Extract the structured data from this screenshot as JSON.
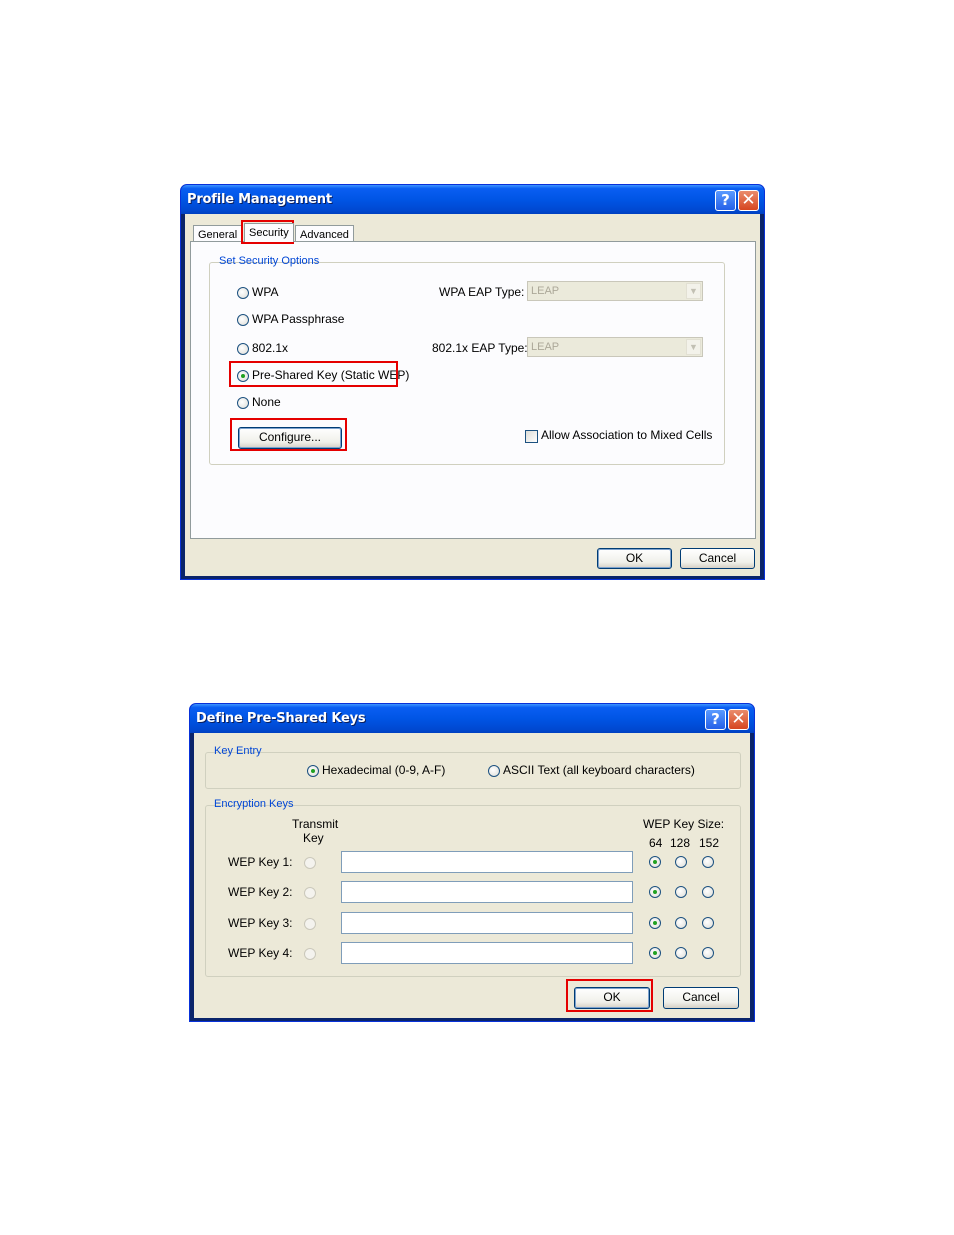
{
  "profile_dialog": {
    "title": "Profile Management",
    "help_glyph": "?",
    "close_glyph": "✕",
    "tabs": [
      "General",
      "Security",
      "Advanced"
    ],
    "active_tab": "Security",
    "group_label": "Set Security Options",
    "options": {
      "wpa": "WPA",
      "wpa_passphrase": "WPA Passphrase",
      "dot1x": "802.1x",
      "psk": "Pre-Shared Key (Static WEP)",
      "none": "None"
    },
    "selected_option": "Pre-Shared Key (Static WEP)",
    "wpa_eap_label": "WPA EAP Type:",
    "wpa_eap_value": "LEAP",
    "dot1x_eap_label": "802.1x EAP Type:",
    "dot1x_eap_value": "LEAP",
    "configure_label": "Configure...",
    "mixed_cells_label": "Allow Association to Mixed Cells",
    "mixed_cells_checked": false,
    "ok_label": "OK",
    "cancel_label": "Cancel"
  },
  "psk_dialog": {
    "title": "Define Pre-Shared Keys",
    "help_glyph": "?",
    "close_glyph": "✕",
    "key_entry_label": "Key Entry",
    "hex_label": "Hexadecimal (0-9, A-F)",
    "ascii_label": "ASCII Text (all keyboard characters)",
    "selected_entry": "Hexadecimal (0-9, A-F)",
    "enc_keys_label": "Encryption Keys",
    "transmit_label_1": "Transmit",
    "transmit_label_2": "Key",
    "size_label": "WEP Key Size:",
    "sizes": [
      "64",
      "128",
      "152"
    ],
    "keys": [
      {
        "label": "WEP Key 1:",
        "value": "",
        "size": "64"
      },
      {
        "label": "WEP Key 2:",
        "value": "",
        "size": "64"
      },
      {
        "label": "WEP Key 3:",
        "value": "",
        "size": "64"
      },
      {
        "label": "WEP Key 4:",
        "value": "",
        "size": "64"
      }
    ],
    "ok_label": "OK",
    "cancel_label": "Cancel"
  },
  "colors": {
    "highlight": "#e50000",
    "titlebar": "#0055e5",
    "dialog_bg": "#ece9d8",
    "radio_dot": "#21a121",
    "legend": "#0046d5"
  }
}
